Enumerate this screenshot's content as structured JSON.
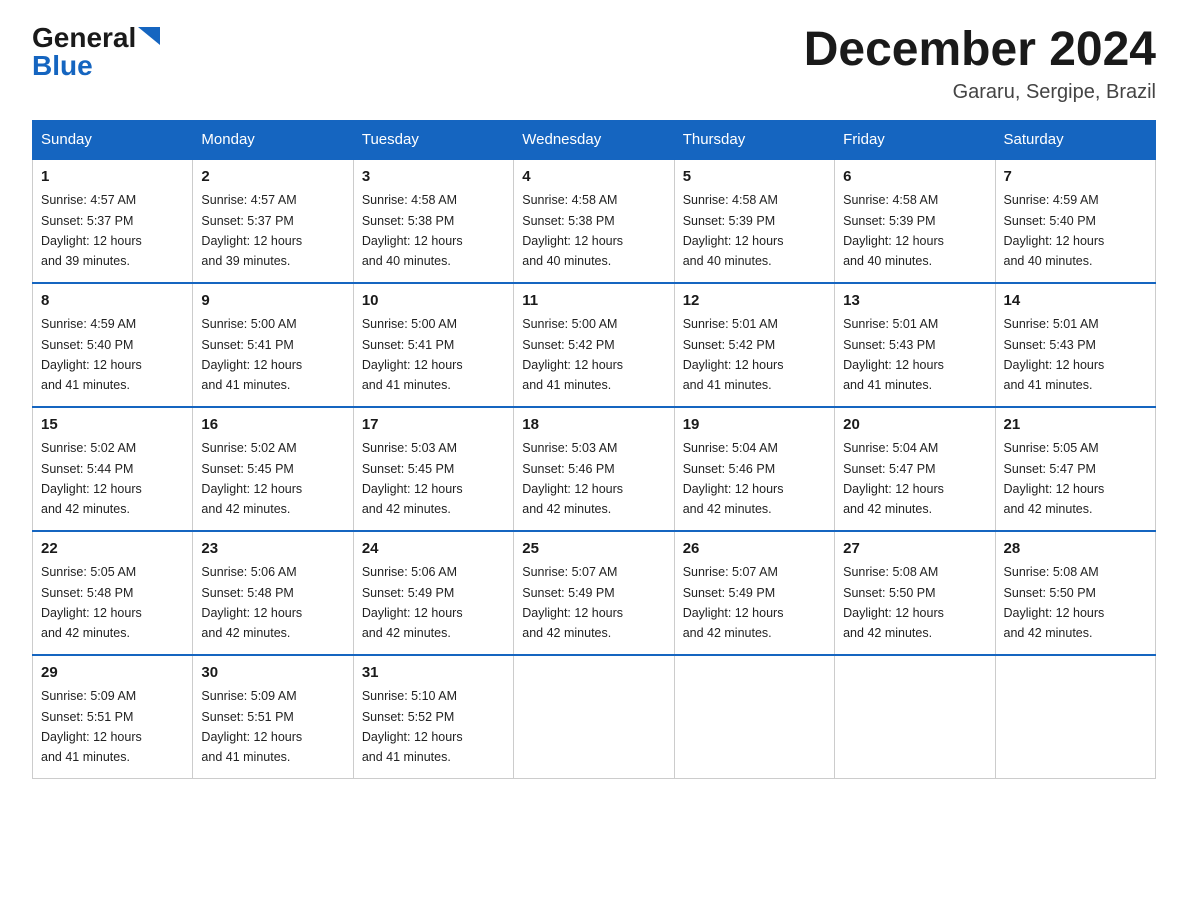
{
  "header": {
    "logo_general": "General",
    "logo_blue": "Blue",
    "month_title": "December 2024",
    "location": "Gararu, Sergipe, Brazil"
  },
  "days_header": [
    "Sunday",
    "Monday",
    "Tuesday",
    "Wednesday",
    "Thursday",
    "Friday",
    "Saturday"
  ],
  "weeks": [
    [
      {
        "day": "1",
        "sunrise": "4:57 AM",
        "sunset": "5:37 PM",
        "daylight": "12 hours and 39 minutes."
      },
      {
        "day": "2",
        "sunrise": "4:57 AM",
        "sunset": "5:37 PM",
        "daylight": "12 hours and 39 minutes."
      },
      {
        "day": "3",
        "sunrise": "4:58 AM",
        "sunset": "5:38 PM",
        "daylight": "12 hours and 40 minutes."
      },
      {
        "day": "4",
        "sunrise": "4:58 AM",
        "sunset": "5:38 PM",
        "daylight": "12 hours and 40 minutes."
      },
      {
        "day": "5",
        "sunrise": "4:58 AM",
        "sunset": "5:39 PM",
        "daylight": "12 hours and 40 minutes."
      },
      {
        "day": "6",
        "sunrise": "4:58 AM",
        "sunset": "5:39 PM",
        "daylight": "12 hours and 40 minutes."
      },
      {
        "day": "7",
        "sunrise": "4:59 AM",
        "sunset": "5:40 PM",
        "daylight": "12 hours and 40 minutes."
      }
    ],
    [
      {
        "day": "8",
        "sunrise": "4:59 AM",
        "sunset": "5:40 PM",
        "daylight": "12 hours and 41 minutes."
      },
      {
        "day": "9",
        "sunrise": "5:00 AM",
        "sunset": "5:41 PM",
        "daylight": "12 hours and 41 minutes."
      },
      {
        "day": "10",
        "sunrise": "5:00 AM",
        "sunset": "5:41 PM",
        "daylight": "12 hours and 41 minutes."
      },
      {
        "day": "11",
        "sunrise": "5:00 AM",
        "sunset": "5:42 PM",
        "daylight": "12 hours and 41 minutes."
      },
      {
        "day": "12",
        "sunrise": "5:01 AM",
        "sunset": "5:42 PM",
        "daylight": "12 hours and 41 minutes."
      },
      {
        "day": "13",
        "sunrise": "5:01 AM",
        "sunset": "5:43 PM",
        "daylight": "12 hours and 41 minutes."
      },
      {
        "day": "14",
        "sunrise": "5:01 AM",
        "sunset": "5:43 PM",
        "daylight": "12 hours and 41 minutes."
      }
    ],
    [
      {
        "day": "15",
        "sunrise": "5:02 AM",
        "sunset": "5:44 PM",
        "daylight": "12 hours and 42 minutes."
      },
      {
        "day": "16",
        "sunrise": "5:02 AM",
        "sunset": "5:45 PM",
        "daylight": "12 hours and 42 minutes."
      },
      {
        "day": "17",
        "sunrise": "5:03 AM",
        "sunset": "5:45 PM",
        "daylight": "12 hours and 42 minutes."
      },
      {
        "day": "18",
        "sunrise": "5:03 AM",
        "sunset": "5:46 PM",
        "daylight": "12 hours and 42 minutes."
      },
      {
        "day": "19",
        "sunrise": "5:04 AM",
        "sunset": "5:46 PM",
        "daylight": "12 hours and 42 minutes."
      },
      {
        "day": "20",
        "sunrise": "5:04 AM",
        "sunset": "5:47 PM",
        "daylight": "12 hours and 42 minutes."
      },
      {
        "day": "21",
        "sunrise": "5:05 AM",
        "sunset": "5:47 PM",
        "daylight": "12 hours and 42 minutes."
      }
    ],
    [
      {
        "day": "22",
        "sunrise": "5:05 AM",
        "sunset": "5:48 PM",
        "daylight": "12 hours and 42 minutes."
      },
      {
        "day": "23",
        "sunrise": "5:06 AM",
        "sunset": "5:48 PM",
        "daylight": "12 hours and 42 minutes."
      },
      {
        "day": "24",
        "sunrise": "5:06 AM",
        "sunset": "5:49 PM",
        "daylight": "12 hours and 42 minutes."
      },
      {
        "day": "25",
        "sunrise": "5:07 AM",
        "sunset": "5:49 PM",
        "daylight": "12 hours and 42 minutes."
      },
      {
        "day": "26",
        "sunrise": "5:07 AM",
        "sunset": "5:49 PM",
        "daylight": "12 hours and 42 minutes."
      },
      {
        "day": "27",
        "sunrise": "5:08 AM",
        "sunset": "5:50 PM",
        "daylight": "12 hours and 42 minutes."
      },
      {
        "day": "28",
        "sunrise": "5:08 AM",
        "sunset": "5:50 PM",
        "daylight": "12 hours and 42 minutes."
      }
    ],
    [
      {
        "day": "29",
        "sunrise": "5:09 AM",
        "sunset": "5:51 PM",
        "daylight": "12 hours and 41 minutes."
      },
      {
        "day": "30",
        "sunrise": "5:09 AM",
        "sunset": "5:51 PM",
        "daylight": "12 hours and 41 minutes."
      },
      {
        "day": "31",
        "sunrise": "5:10 AM",
        "sunset": "5:52 PM",
        "daylight": "12 hours and 41 minutes."
      },
      null,
      null,
      null,
      null
    ]
  ],
  "labels": {
    "sunrise": "Sunrise:",
    "sunset": "Sunset:",
    "daylight": "Daylight:"
  }
}
